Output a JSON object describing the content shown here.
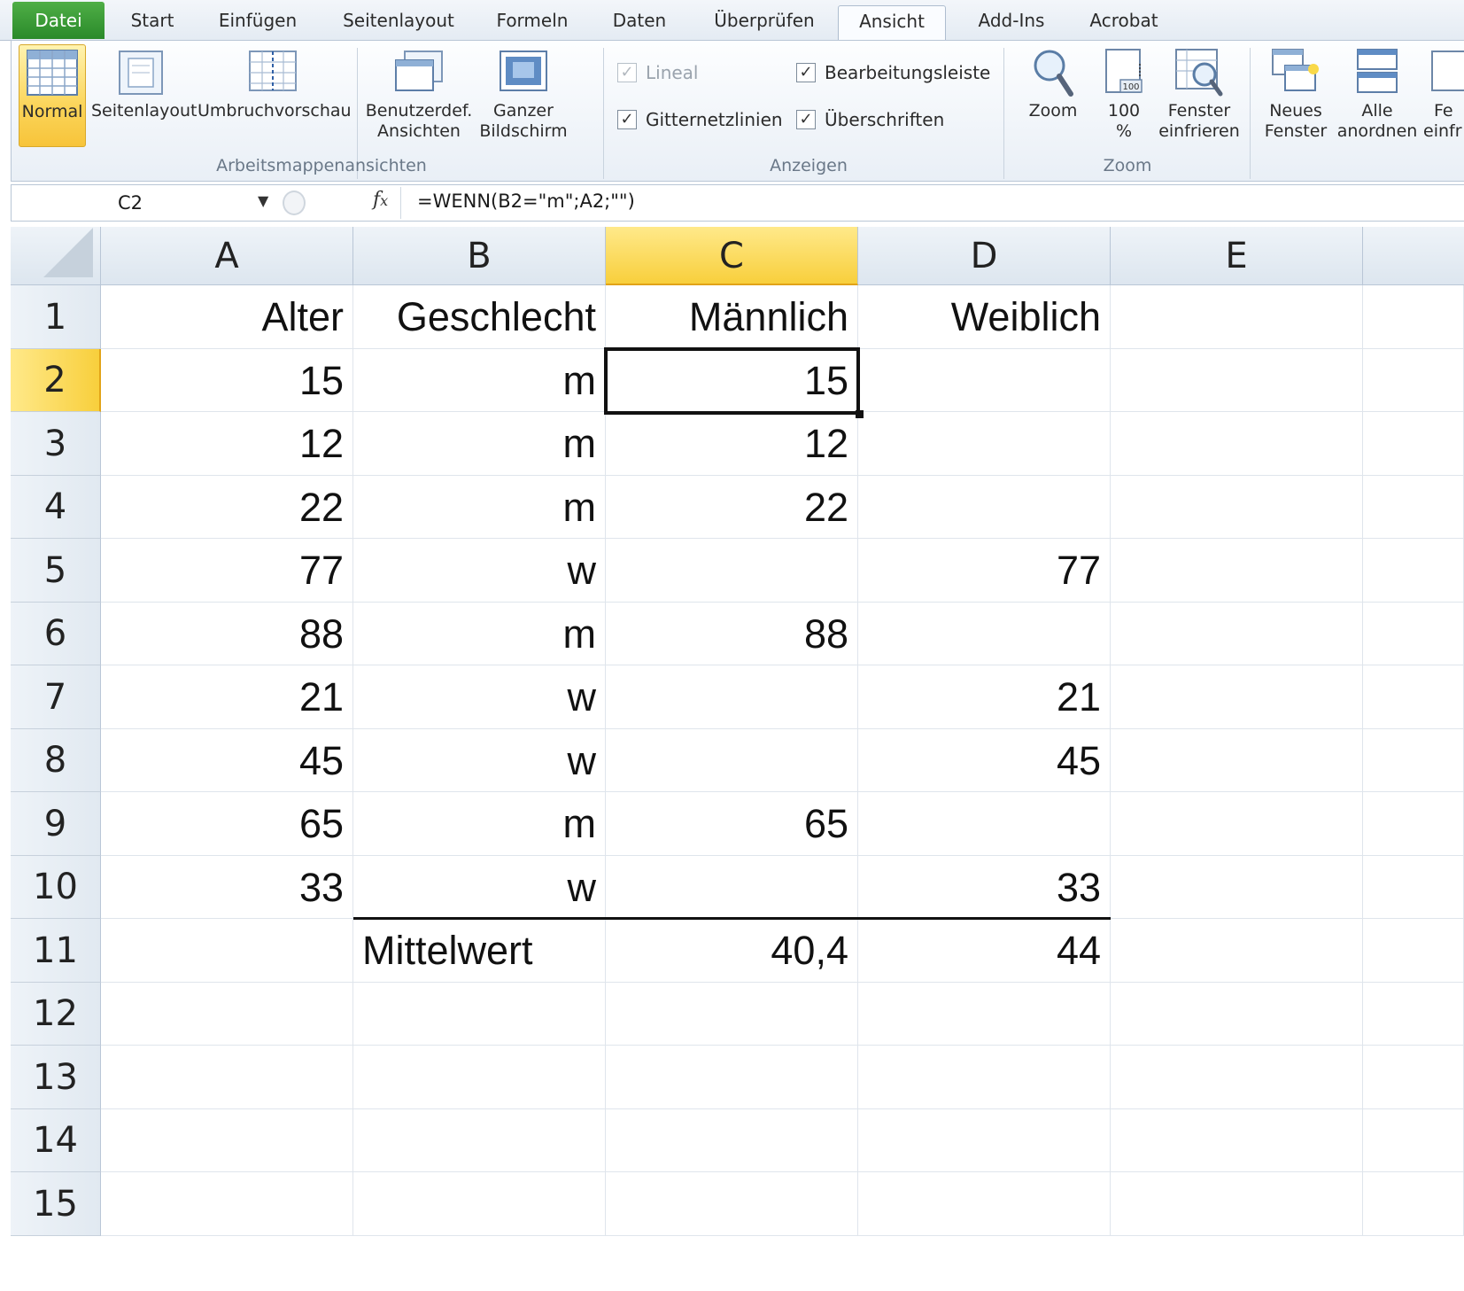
{
  "tabs": [
    "Datei",
    "Start",
    "Einfügen",
    "Seitenlayout",
    "Formeln",
    "Daten",
    "Überprüfen",
    "Ansicht",
    "Add-Ins",
    "Acrobat"
  ],
  "active_tab": "Ansicht",
  "ribbon": {
    "workbook_views": {
      "label": "Arbeitsmappenansichten",
      "normal": "Normal",
      "page_layout": "Seitenlayout",
      "page_break": "Umbruchvorschau",
      "custom_views_1": "Benutzerdef.",
      "custom_views_2": "Ansichten",
      "fullscreen_1": "Ganzer",
      "fullscreen_2": "Bildschirm"
    },
    "show": {
      "label": "Anzeigen",
      "ruler": "Lineal",
      "formula_bar": "Bearbeitungsleiste",
      "gridlines": "Gitternetzlinien",
      "headings": "Überschriften",
      "ruler_checked": true,
      "formula_bar_checked": true,
      "gridlines_checked": true,
      "headings_checked": true
    },
    "zoom": {
      "label": "Zoom",
      "zoom": "Zoom",
      "hundred_1": "100",
      "hundred_2": "%",
      "freeze_1": "Fenster",
      "freeze_2": "einfrieren"
    },
    "window": {
      "new_window_1": "Neues",
      "new_window_2": "Fenster",
      "arrange_1": "Alle",
      "arrange_2": "anordnen",
      "partial_1": "Fe",
      "partial_2": "einfr"
    }
  },
  "formula_bar": {
    "name_box": "C2",
    "formula": "=WENN(B2=\"m\";A2;\"\")",
    "fx": "fx"
  },
  "grid": {
    "columns": [
      "A",
      "B",
      "C",
      "D",
      "E"
    ],
    "selected_column": "C",
    "selected_row": 2,
    "rows": [
      {
        "n": "1",
        "A": "Alter",
        "B": "Geschlecht",
        "C": "Männlich",
        "D": "Weiblich"
      },
      {
        "n": "2",
        "A": "15",
        "B": "m",
        "C": "15",
        "D": ""
      },
      {
        "n": "3",
        "A": "12",
        "B": "m",
        "C": "12",
        "D": ""
      },
      {
        "n": "4",
        "A": "22",
        "B": "m",
        "C": "22",
        "D": ""
      },
      {
        "n": "5",
        "A": "77",
        "B": "w",
        "C": "",
        "D": "77"
      },
      {
        "n": "6",
        "A": "88",
        "B": "m",
        "C": "88",
        "D": ""
      },
      {
        "n": "7",
        "A": "21",
        "B": "w",
        "C": "",
        "D": "21"
      },
      {
        "n": "8",
        "A": "45",
        "B": "w",
        "C": "",
        "D": "45"
      },
      {
        "n": "9",
        "A": "65",
        "B": "m",
        "C": "65",
        "D": ""
      },
      {
        "n": "10",
        "A": "33",
        "B": "w",
        "C": "",
        "D": "33"
      },
      {
        "n": "11",
        "A": "",
        "B": "Mittelwert",
        "C": "40,4",
        "D": "44"
      },
      {
        "n": "12",
        "A": "",
        "B": "",
        "C": "",
        "D": ""
      },
      {
        "n": "13",
        "A": "",
        "B": "",
        "C": "",
        "D": ""
      },
      {
        "n": "14",
        "A": "",
        "B": "",
        "C": "",
        "D": ""
      },
      {
        "n": "15",
        "A": "",
        "B": "",
        "C": "",
        "D": ""
      }
    ]
  },
  "colors": {
    "accent_green": "#2a8a2a",
    "selection_gold": "#f8cf3c",
    "header_bg": "#dde6ef"
  }
}
